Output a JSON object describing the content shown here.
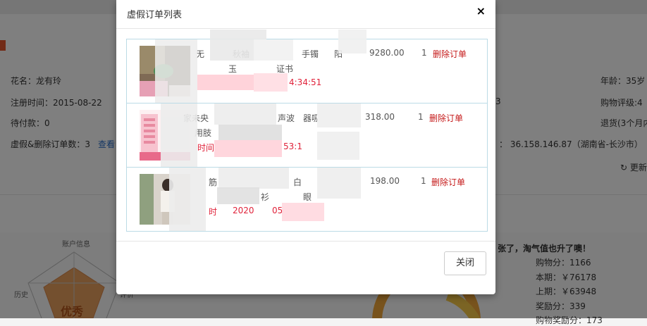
{
  "background": {
    "flower_name": "花名：龙有玲",
    "age": "年龄：35岁",
    "register_time": "注册时间：2015-08-22",
    "rating_suffix": "3",
    "shopping_rating": "购物评级:4",
    "pending_payment": "待付款：0",
    "returns": "退货(3个月内",
    "fake_deleted_count": "虚假&删除订单数：3",
    "view_link": "查看",
    "ip_address": "：  36.158.146.87（湖南省-长沙市）",
    "refresh": "更新",
    "promo_text": "张了，淘气值也升了噢！",
    "stats": [
      "购物分：1166",
      "本期：￥76178",
      "上期：￥63948",
      "奖励分：339",
      "购物奖励分：173"
    ],
    "radar_labels": {
      "top": "账户信息",
      "left": "历史",
      "right": "评价历史"
    },
    "radar_grade": "优秀"
  },
  "modal": {
    "title": "虚假订单列表",
    "close_icon": "×",
    "close_button": "关闭",
    "orders": [
      {
        "title_line1": "无",
        "title_line1b": "秋袖",
        "title_line1c": "手镯",
        "title_line1d": "阳",
        "title_line2": "玉",
        "title_line2b": "证书",
        "time": "4:34:51",
        "time_prefix": "时",
        "price": "9280.00",
        "quantity": "1",
        "delete": "删除订单"
      },
      {
        "title_line1": "家未央",
        "title_line1b": "声波",
        "title_line1c": "器吸",
        "title_line2": "用肢",
        "time": "53:1",
        "time_prefix": "时间",
        "price": "318.00",
        "quantity": "1",
        "delete": "删除订单"
      },
      {
        "title_line1": "筋",
        "title_line1b": "白",
        "title_line2": "衫",
        "title_line2b": "眼",
        "time_prefix": "时",
        "time": "2020",
        "time_suffix": "05",
        "price": "198.00",
        "quantity": "1",
        "delete": "删除订单"
      }
    ]
  }
}
